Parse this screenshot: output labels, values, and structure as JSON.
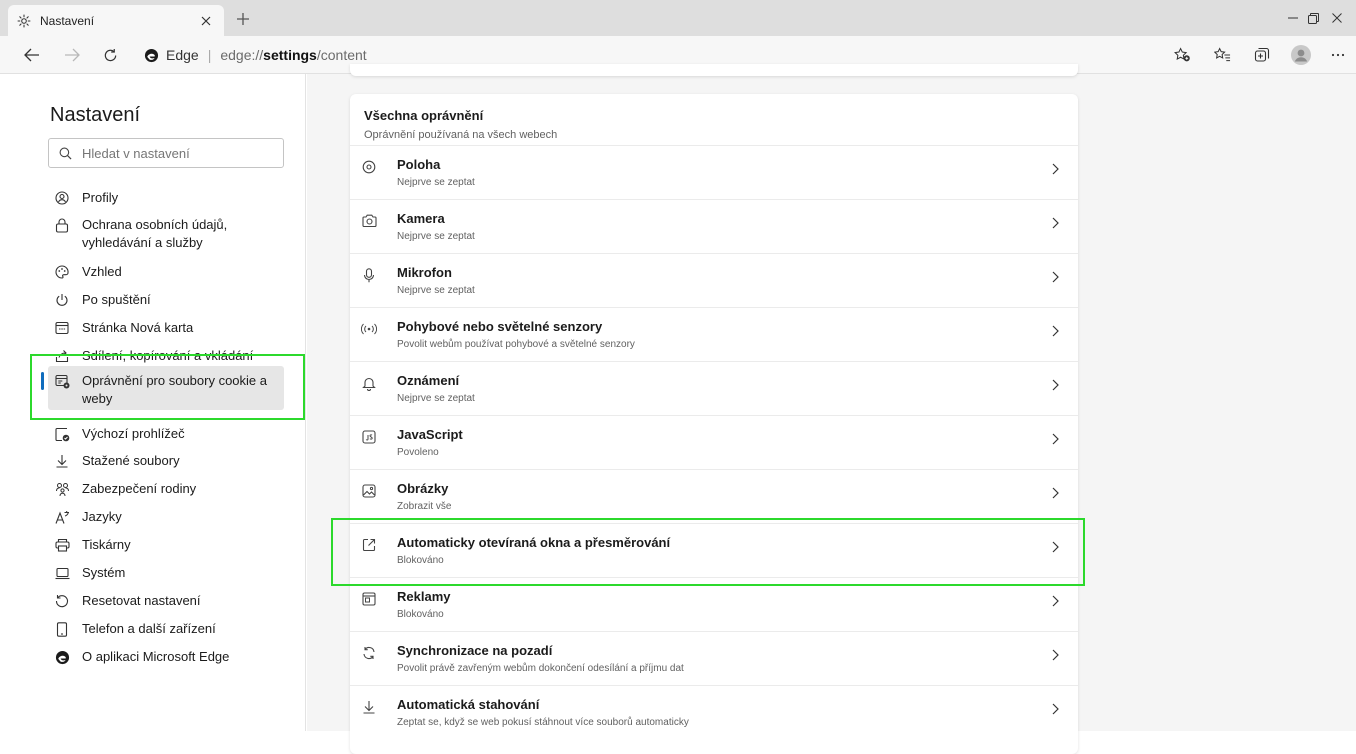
{
  "browser": {
    "tab_title": "Nastavení",
    "address": {
      "site_name": "Edge",
      "url_prefix": "edge://",
      "url_bold": "settings",
      "url_suffix": "/content"
    }
  },
  "sidebar": {
    "title": "Nastavení",
    "search_placeholder": "Hledat v nastavení",
    "items": [
      {
        "label": "Profily",
        "icon": "profile-icon"
      },
      {
        "label": "Ochrana osobních údajů, vyhledávání a služby",
        "icon": "lock-icon"
      },
      {
        "label": "Vzhled",
        "icon": "appearance-icon"
      },
      {
        "label": "Po spuštění",
        "icon": "power-icon"
      },
      {
        "label": "Stránka Nová karta",
        "icon": "new-tab-page-icon"
      },
      {
        "label": "Sdílení, kopírování a vkládání",
        "icon": "share-icon"
      },
      {
        "label": "Oprávnění pro soubory cookie a weby",
        "icon": "cookie-site-permissions-icon",
        "active": true
      },
      {
        "label": "Výchozí prohlížeč",
        "icon": "default-browser-icon"
      },
      {
        "label": "Stažené soubory",
        "icon": "download-icon"
      },
      {
        "label": "Zabezpečení rodiny",
        "icon": "family-icon"
      },
      {
        "label": "Jazyky",
        "icon": "languages-icon"
      },
      {
        "label": "Tiskárny",
        "icon": "printer-icon"
      },
      {
        "label": "Systém",
        "icon": "system-icon"
      },
      {
        "label": "Resetovat nastavení",
        "icon": "reset-icon"
      },
      {
        "label": "Telefon a další zařízení",
        "icon": "phone-icon"
      },
      {
        "label": "O aplikaci Microsoft Edge",
        "icon": "edge-logo-icon"
      }
    ]
  },
  "permissions": {
    "title": "Všechna oprávnění",
    "subtitle": "Oprávnění používaná na všech webech",
    "rows": [
      {
        "name": "Poloha",
        "status": "Nejprve se zeptat",
        "icon": "location-icon"
      },
      {
        "name": "Kamera",
        "status": "Nejprve se zeptat",
        "icon": "camera-icon"
      },
      {
        "name": "Mikrofon",
        "status": "Nejprve se zeptat",
        "icon": "microphone-icon"
      },
      {
        "name": "Pohybové nebo světelné senzory",
        "status": "Povolit webům používat pohybové a světelné senzory",
        "icon": "sensors-icon"
      },
      {
        "name": "Oznámení",
        "status": "Nejprve se zeptat",
        "icon": "bell-icon"
      },
      {
        "name": "JavaScript",
        "status": "Povoleno",
        "icon": "javascript-icon"
      },
      {
        "name": "Obrázky",
        "status": "Zobrazit vše",
        "icon": "image-icon"
      },
      {
        "name": "Automaticky otevíraná okna a přesměrování",
        "status": "Blokováno",
        "icon": "popup-icon"
      },
      {
        "name": "Reklamy",
        "status": "Blokováno",
        "icon": "ads-icon"
      },
      {
        "name": "Synchronizace na pozadí",
        "status": "Povolit právě zavřeným webům dokončení odesílání a příjmu dat",
        "icon": "sync-icon"
      },
      {
        "name": "Automatická stahování",
        "status": "Zeptat se, když se web pokusí stáhnout více souborů automaticky",
        "icon": "auto-download-icon"
      }
    ]
  },
  "colors": {
    "accent": "#0f6cbd",
    "highlight": "#2cd92c"
  }
}
